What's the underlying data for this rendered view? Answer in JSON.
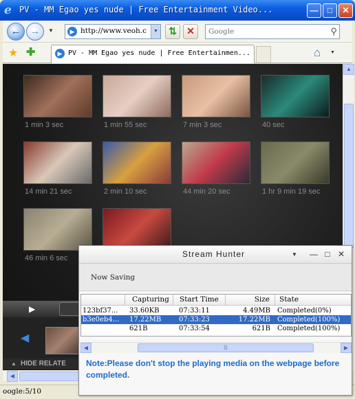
{
  "window": {
    "title": "PV - MM Egao yes nude | Free Entertainment Video..."
  },
  "nav": {
    "back_icon": "back-arrow-icon",
    "forward_icon": "forward-arrow-icon",
    "address_url": "http://www.veoh.co",
    "search_placeholder": "Google"
  },
  "tabs": {
    "active_label": "PV - MM Egao yes nude | Free Entertainmen..."
  },
  "videos": [
    {
      "duration": "1 min 3 sec",
      "colors": [
        "#3b2a20",
        "#a0705a",
        "#5e3b2a"
      ]
    },
    {
      "duration": "1 min 55 sec",
      "colors": [
        "#c9a898",
        "#e6cfc4",
        "#8e6a5c"
      ]
    },
    {
      "duration": "7 min 3 sec",
      "colors": [
        "#c89a7c",
        "#e8c0a4",
        "#7a5440"
      ]
    },
    {
      "duration": "40 sec",
      "colors": [
        "#1c2a2a",
        "#2a8a7a",
        "#0e1a1c"
      ]
    },
    {
      "duration": "14 min 21 sec",
      "colors": [
        "#8a3a30",
        "#d8c8b8",
        "#6a6a6a"
      ]
    },
    {
      "duration": "2 min 10 sec",
      "colors": [
        "#3a5aa8",
        "#d8a040",
        "#8a3a3a"
      ]
    },
    {
      "duration": "44 min 20 sec",
      "colors": [
        "#b8a890",
        "#c03a4a",
        "#2a2a3a"
      ]
    },
    {
      "duration": "1 hr 9 min 19 sec",
      "colors": [
        "#6a6a50",
        "#8a8a6a",
        "#3a3a2a"
      ]
    },
    {
      "duration": "46 min 6 sec",
      "colors": [
        "#8a8270",
        "#b8ae94",
        "#5a5444"
      ]
    },
    {
      "duration": "",
      "colors": [
        "#7a1a20",
        "#c84a40",
        "#3a1a1a"
      ]
    }
  ],
  "player": {
    "hide_related_label": "HIDE RELATE"
  },
  "status": {
    "text": "oogle:5/10"
  },
  "stream_hunter": {
    "title": "Stream Hunter",
    "now_saving_label": "Now Saving",
    "columns": [
      "Capturing",
      "Start Time",
      "Size",
      "State"
    ],
    "rows": [
      {
        "id": "123bf37...",
        "capturing": "33.60KB",
        "start_time": "07:33:11",
        "size": "4.49MB",
        "state": "Completed(0%)",
        "selected": false
      },
      {
        "id": "b3e0eb4...",
        "capturing": "17.22MB",
        "start_time": "07:33:23",
        "size": "17.22MB",
        "state": "Completed(100%)",
        "selected": true
      },
      {
        "id": "",
        "capturing": "621B",
        "start_time": "07:33:54",
        "size": "621B",
        "state": "Completed(100%)",
        "selected": false
      }
    ],
    "note": "Note:Please don't stop the playing media on the webpage before completed."
  }
}
